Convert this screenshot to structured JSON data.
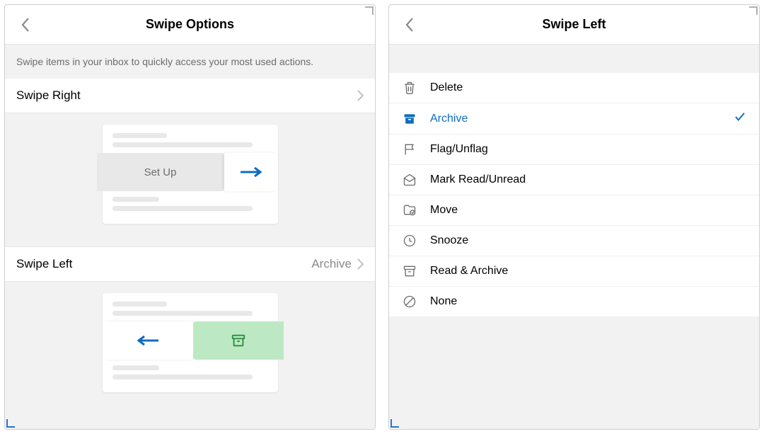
{
  "left": {
    "title": "Swipe Options",
    "desc": "Swipe items in your inbox to quickly access your most used actions.",
    "swipe_right": {
      "label": "Swipe Right",
      "action_label": "Set Up"
    },
    "swipe_left": {
      "label": "Swipe Left",
      "value": "Archive"
    }
  },
  "right": {
    "title": "Swipe Left",
    "actions": [
      {
        "key": "delete",
        "label": "Delete",
        "selected": false
      },
      {
        "key": "archive",
        "label": "Archive",
        "selected": true
      },
      {
        "key": "flag",
        "label": "Flag/Unflag",
        "selected": false
      },
      {
        "key": "readunread",
        "label": "Mark Read/Unread",
        "selected": false
      },
      {
        "key": "move",
        "label": "Move",
        "selected": false
      },
      {
        "key": "snooze",
        "label": "Snooze",
        "selected": false
      },
      {
        "key": "readarchive",
        "label": "Read & Archive",
        "selected": false
      },
      {
        "key": "none",
        "label": "None",
        "selected": false
      }
    ]
  }
}
